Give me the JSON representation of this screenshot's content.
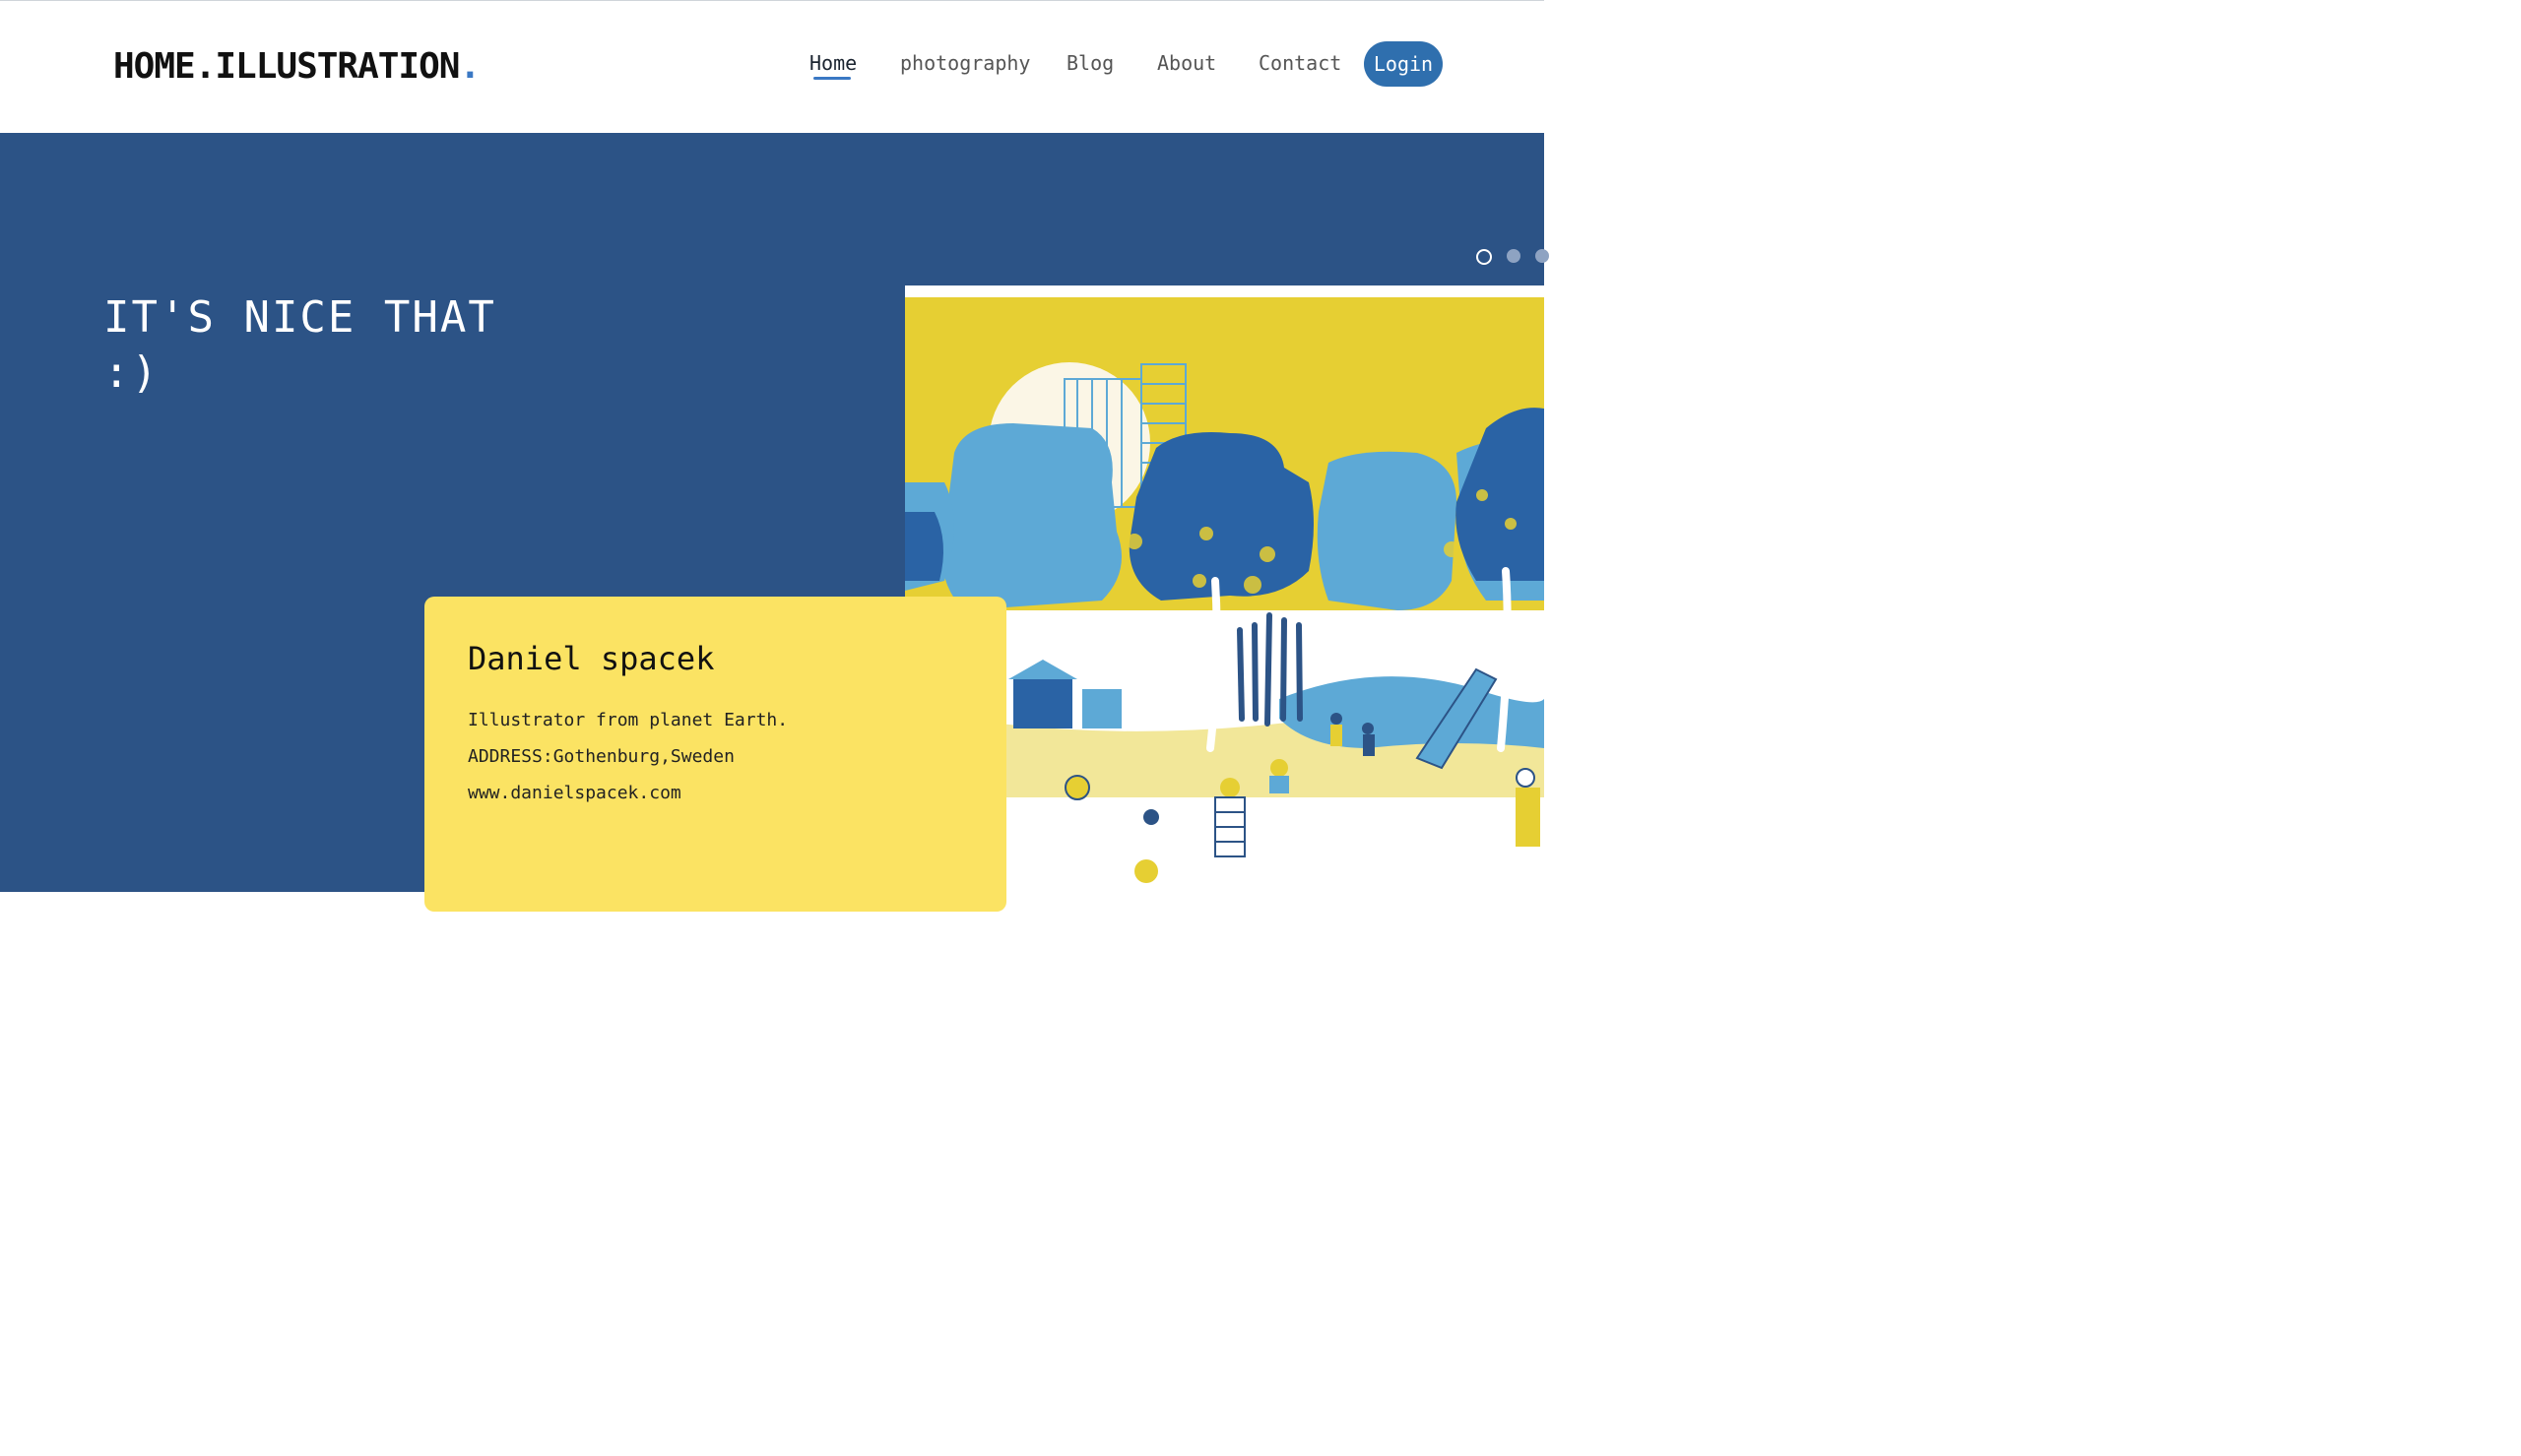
{
  "header": {
    "logo_text": "HOME.ILLUSTRATION",
    "logo_dot": ".",
    "nav": [
      {
        "label": "Home",
        "active": true
      },
      {
        "label": "photography"
      },
      {
        "label": "Blog"
      },
      {
        "label": "About"
      },
      {
        "label": "Contact"
      }
    ],
    "login_label": "Login"
  },
  "hero": {
    "title": "IT'S NICE THAT\n:)",
    "carousel": {
      "slides": 3,
      "active": 0
    },
    "illustration_icon": "park-illustration"
  },
  "card": {
    "name": "Daniel spacek",
    "tagline": "Illustrator from planet Earth.",
    "address": "ADDRESS:Gothenburg,Sweden",
    "website": "www.danielspacek.com"
  },
  "colors": {
    "hero_bg": "#2c5386",
    "card_bg": "#fbe363",
    "accent": "#3a78c4",
    "login_bg": "#2f6fae",
    "illus_yellow": "#e8d030",
    "illus_blue_dark": "#2a63a5",
    "illus_blue_light": "#5da9d6"
  }
}
